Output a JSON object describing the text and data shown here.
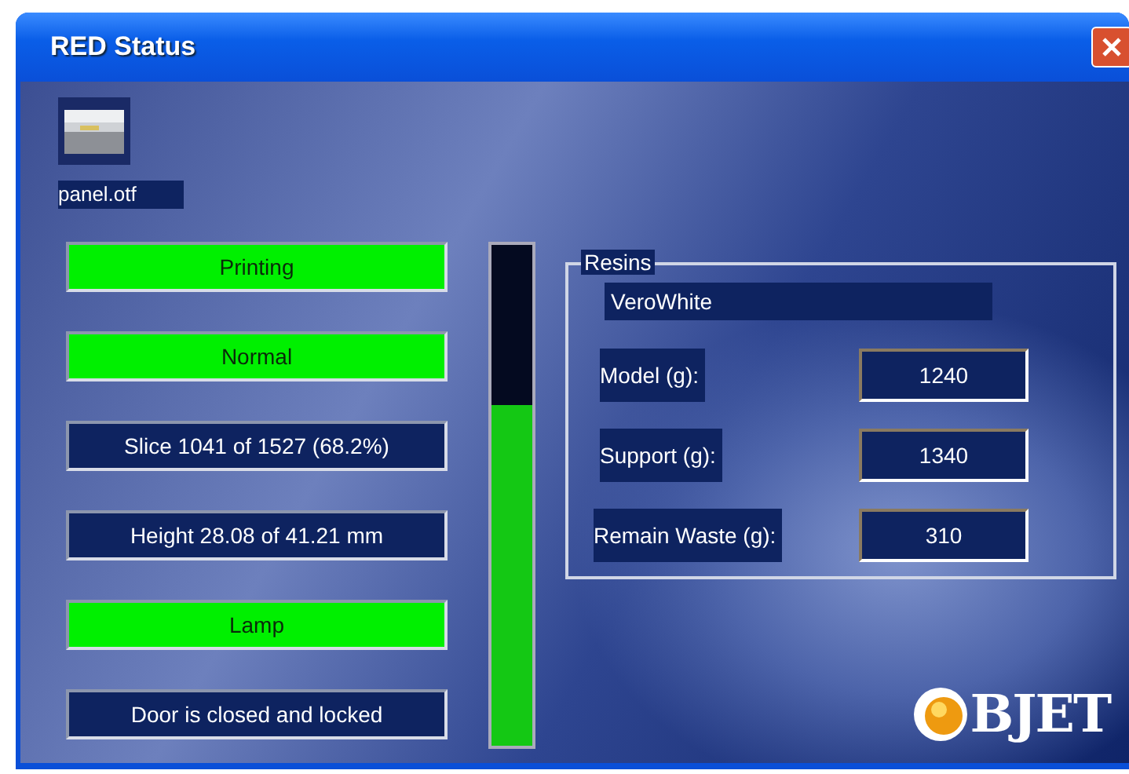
{
  "window": {
    "title": "RED Status"
  },
  "machine": {
    "file": "panel.otf"
  },
  "statuses": [
    {
      "text": "Printing",
      "on": true
    },
    {
      "text": "Normal",
      "on": true
    },
    {
      "text": "Slice 1041 of 1527 (68.2%)",
      "on": false
    },
    {
      "text": "Height 28.08 of 41.21 mm",
      "on": false
    },
    {
      "text": "Lamp",
      "on": true
    },
    {
      "text": "Door is closed and locked",
      "on": false
    }
  ],
  "progress": {
    "level": 0.68
  },
  "resins": {
    "title": "Resins",
    "material": "VeroWhite",
    "rows": [
      {
        "label": "Model (g):",
        "value": "1240"
      },
      {
        "label": "Support (g):",
        "value": "1340"
      },
      {
        "label": "Remain Waste (g):",
        "value": "310"
      }
    ]
  },
  "logo": {
    "text": "BJET"
  }
}
